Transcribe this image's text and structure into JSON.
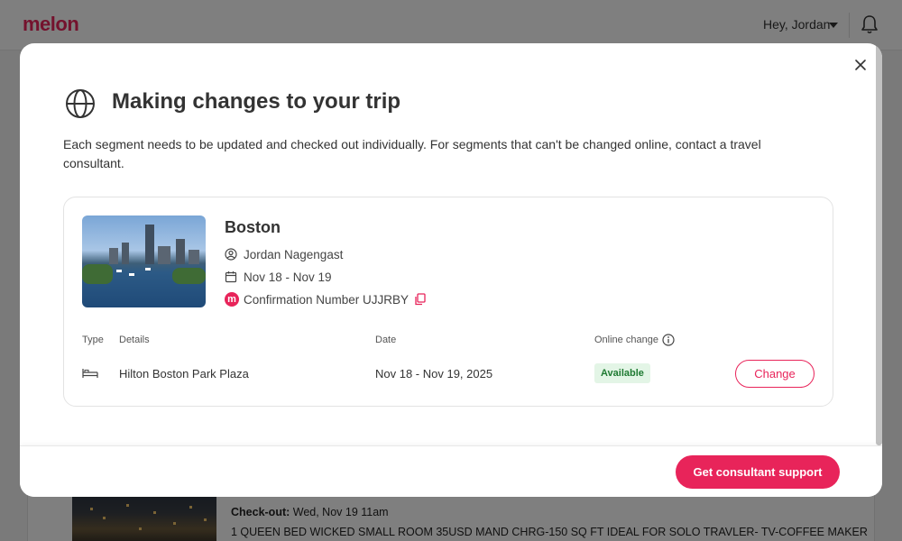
{
  "app": {
    "logo": "melon"
  },
  "header": {
    "greeting": "Hey, Jordan"
  },
  "background": {
    "checkout_label": "Check-out:",
    "checkout_value": " Wed, Nov 19 11am",
    "room_description": "1 QUEEN BED WICKED SMALL ROOM 35USD MAND CHRG-150 SQ FT IDEAL FOR SOLO TRAVLER- TV-COFFEE MAKER"
  },
  "modal": {
    "title": "Making changes to your trip",
    "intro": "Each segment needs to be updated and checked out individually. For segments that can't be changed online, contact a travel consultant.",
    "segment": {
      "city": "Boston",
      "traveler": "Jordan Nagengast",
      "dates": "Nov 18 - Nov 19",
      "confirmation": "Confirmation Number UJJRBY",
      "columns": {
        "type": "Type",
        "details": "Details",
        "date": "Date",
        "online_change": "Online change"
      },
      "row": {
        "details": "Hilton Boston Park Plaza",
        "date": "Nov 18 - Nov 19, 2025",
        "status": "Available",
        "action": "Change"
      }
    },
    "footer": {
      "consultant_button": "Get consultant support"
    }
  },
  "colors": {
    "brand": "#e8245a",
    "available_bg": "#e3f5e6",
    "available_text": "#1f7a32"
  },
  "icons": [
    "bell-icon",
    "globe-icon",
    "close-icon",
    "user-icon",
    "calendar-icon",
    "copy-icon",
    "info-icon",
    "bed-icon"
  ]
}
